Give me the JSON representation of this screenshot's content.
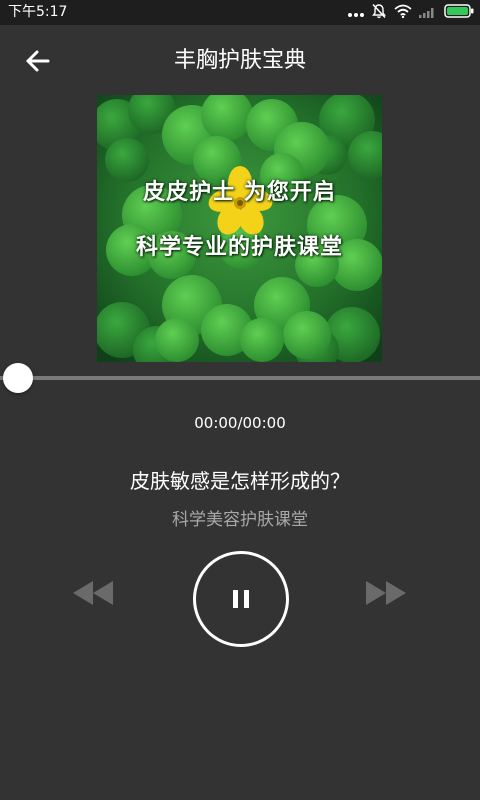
{
  "status_bar": {
    "time": "下午5:17",
    "icons": [
      "more-dots-icon",
      "notifications-off-icon",
      "wifi-icon",
      "signal-icon",
      "battery-icon"
    ],
    "battery_color": "#34c759"
  },
  "header": {
    "title": "丰胸护肤宝典",
    "back_icon": "arrow-left-icon"
  },
  "album_art": {
    "caption_line1": "皮皮护士  为您开启",
    "caption_line2": "科学专业的护肤课堂"
  },
  "player": {
    "progress": 0,
    "time_display": "00:00/00:00",
    "track_title": "皮肤敏感是怎样形成的？",
    "track_subtitle": "科学美容护肤课堂",
    "controls": {
      "rewind_icon": "rewind-icon",
      "pause_icon": "pause-icon",
      "forward_icon": "fast-forward-icon"
    }
  },
  "colors": {
    "background": "#333333",
    "status_bar": "#1e1e1e",
    "text_primary": "#ffffff",
    "text_secondary": "#a8a8a8",
    "control_disabled": "#6a6a6a",
    "track": "#7a7a7a"
  }
}
